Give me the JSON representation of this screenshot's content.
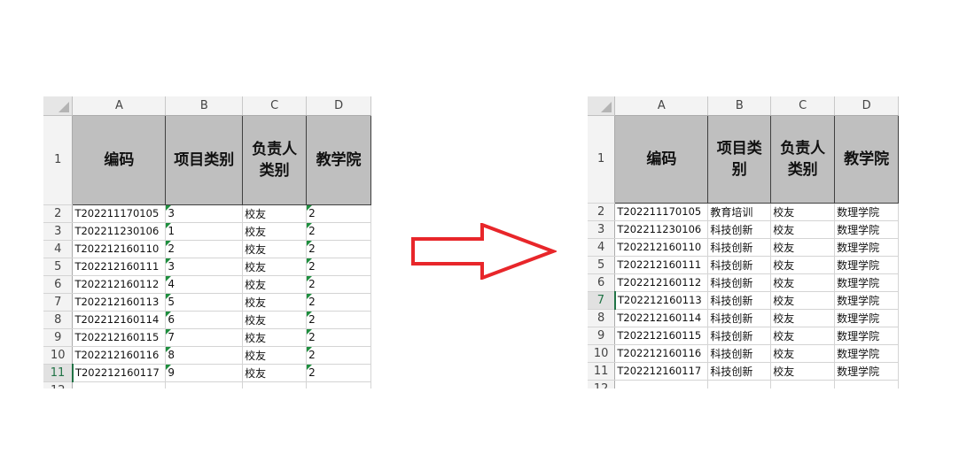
{
  "column_headers": [
    "A",
    "B",
    "C",
    "D"
  ],
  "table_headers": [
    "编码",
    "项目类别",
    "负责人类别",
    "教学院"
  ],
  "row_numbers": [
    "1",
    "2",
    "3",
    "4",
    "5",
    "6",
    "7",
    "8",
    "9",
    "10",
    "11",
    "12"
  ],
  "left_sheet": {
    "selected_row": "11",
    "rows": [
      [
        "T202211170105",
        "3",
        "校友",
        "2"
      ],
      [
        "T202211230106",
        "1",
        "校友",
        "2"
      ],
      [
        "T202212160110",
        "2",
        "校友",
        "2"
      ],
      [
        "T202212160111",
        "3",
        "校友",
        "2"
      ],
      [
        "T202212160112",
        "4",
        "校友",
        "2"
      ],
      [
        "T202212160113",
        "5",
        "校友",
        "2"
      ],
      [
        "T202212160114",
        "6",
        "校友",
        "2"
      ],
      [
        "T202212160115",
        "7",
        "校友",
        "2"
      ],
      [
        "T202212160116",
        "8",
        "校友",
        "2"
      ],
      [
        "T202212160117",
        "9",
        "校友",
        "2"
      ]
    ]
  },
  "right_sheet": {
    "selected_row": "7",
    "rows": [
      [
        "T202211170105",
        "教育培训",
        "校友",
        "数理学院"
      ],
      [
        "T202211230106",
        "科技创新",
        "校友",
        "数理学院"
      ],
      [
        "T202212160110",
        "科技创新",
        "校友",
        "数理学院"
      ],
      [
        "T202212160111",
        "科技创新",
        "校友",
        "数理学院"
      ],
      [
        "T202212160112",
        "科技创新",
        "校友",
        "数理学院"
      ],
      [
        "T202212160113",
        "科技创新",
        "校友",
        "数理学院"
      ],
      [
        "T202212160114",
        "科技创新",
        "校友",
        "数理学院"
      ],
      [
        "T202212160115",
        "科技创新",
        "校友",
        "数理学院"
      ],
      [
        "T202212160116",
        "科技创新",
        "校友",
        "数理学院"
      ],
      [
        "T202212160117",
        "科技创新",
        "校友",
        "数理学院"
      ]
    ]
  },
  "colors": {
    "arrow": "#e8262a",
    "header_fill": "#bfbfbf",
    "selection_green": "#217346",
    "number_as_text_marker": "#1e8e3e"
  },
  "icons": [
    "right-arrow-icon"
  ]
}
